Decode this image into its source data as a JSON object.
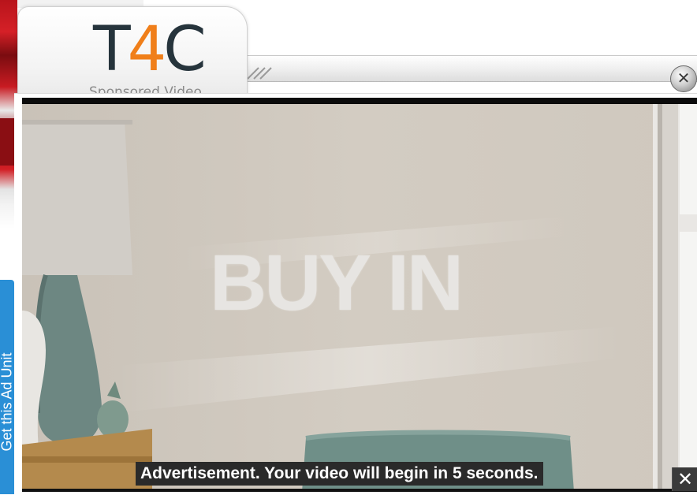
{
  "ad_tab": {
    "logo_t": "T",
    "logo_4": "4",
    "logo_c": "C",
    "subtitle": "Sponsored Video"
  },
  "side_tab": {
    "label": "Get this Ad Unit"
  },
  "video": {
    "headline": "BUY IN",
    "notice": "Advertisement. Your video will begin in 5 seconds."
  },
  "controls": {
    "close_top_glyph": "✕",
    "close_video_glyph": "✕"
  },
  "colors": {
    "logo_dark": "#26343c",
    "logo_accent": "#f07f1a",
    "side_tab": "#2a8fd6"
  }
}
